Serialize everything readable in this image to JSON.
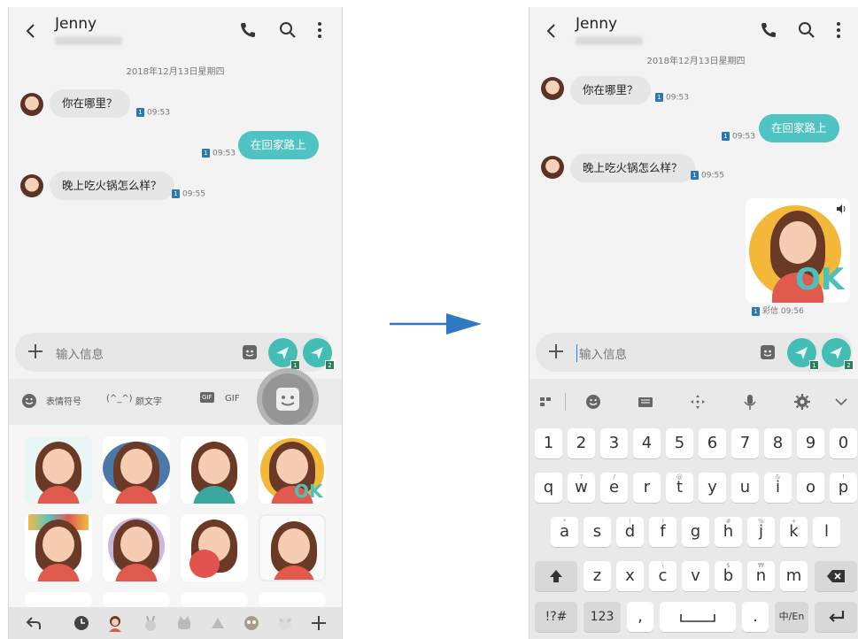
{
  "contact": {
    "name": "Jenny"
  },
  "date": "2018年12月13日星期四",
  "messages": {
    "m1": {
      "text": "你在哪里？",
      "time": "09:53"
    },
    "m2": {
      "text": "在回家路上",
      "time": "09:53"
    },
    "m3": {
      "text": "晚上吃火锅怎么样？",
      "time": "09:55"
    },
    "m4": {
      "label": "彩信",
      "time": "09:56"
    }
  },
  "sim": {
    "badge1": "1",
    "badge2": "2"
  },
  "input": {
    "placeholder": "输入信息"
  },
  "sticker_panel": {
    "tabs": {
      "emoji": "表情符号",
      "kaomoji_sym": "(^_^)",
      "kaomoji": "颜文字",
      "gif_badge": "GIF",
      "gif": "GIF"
    }
  },
  "keyboard": {
    "numbers": [
      "1",
      "2",
      "3",
      "4",
      "5",
      "6",
      "7",
      "8",
      "9",
      "0"
    ],
    "row1": [
      "q",
      "w",
      "e",
      "r",
      "t",
      "y",
      "u",
      "i",
      "o",
      "p"
    ],
    "row1_sup": [
      "",
      "?",
      "/",
      "",
      "@",
      "",
      "",
      "&",
      "",
      "!"
    ],
    "row2": [
      "a",
      "s",
      "d",
      "f",
      "g",
      "h",
      "j",
      "k",
      "l"
    ],
    "row2_sup": [
      "*",
      "",
      "(",
      ")",
      "",
      "#",
      "%",
      "+",
      ""
    ],
    "row3": [
      "z",
      "x",
      "c",
      "v",
      "b",
      "n",
      "m"
    ],
    "row3_sup": [
      "",
      "",
      "\\",
      "",
      "$",
      "₩",
      ""
    ],
    "sym": "!?#",
    "num": "123",
    "comma": ",",
    "period": ".",
    "lang": "中/En"
  },
  "colors": {
    "accent": "#4fc3c1",
    "arrow": "#2f79c2"
  }
}
